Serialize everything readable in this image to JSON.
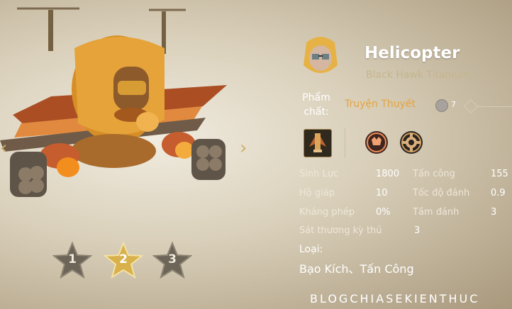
{
  "hero": {
    "name": "Helicopter",
    "skin": "Black Hawk Titanium",
    "quality_label": "Phẩm chất:",
    "quality_value": "Truyện Thuyết",
    "quality_count": "7"
  },
  "stars": [
    {
      "label": "1",
      "active": false
    },
    {
      "label": "2",
      "active": true
    },
    {
      "label": "3",
      "active": false
    }
  ],
  "stats": {
    "hp_label": "Sinh Lực",
    "hp_value": "1800",
    "attack_label": "Tấn công",
    "attack_value": "155",
    "armor_label": "Hộ giáp",
    "armor_value": "10",
    "atk_speed_label": "Tốc độ đánh",
    "atk_speed_value": "0.9",
    "mres_label": "Kháng phép",
    "mres_value": "0%",
    "range_label": "Tầm đánh",
    "range_value": "3",
    "crit_label": "Sát thương kỳ thủ",
    "crit_value": "3"
  },
  "type": {
    "label": "Loại:",
    "value": "Bạo Kích、Tấn Công"
  },
  "watermark": "BLOGCHIASEKIENTHUC",
  "icons": {
    "left": "chevron-left-icon",
    "right": "chevron-right-icon",
    "skill": "missile-icon",
    "fox": "fox-icon",
    "gear": "gear-icon"
  }
}
